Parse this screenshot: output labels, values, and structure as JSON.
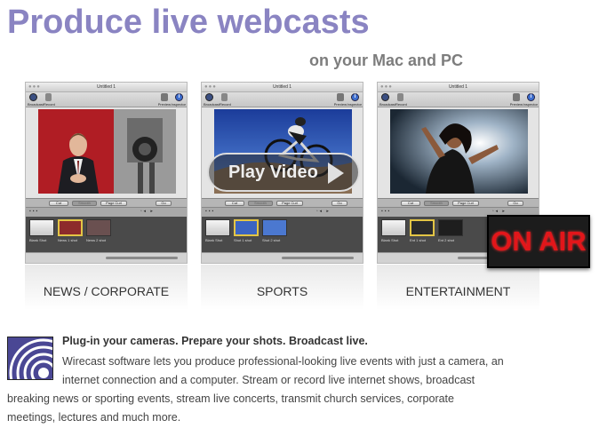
{
  "headline": "Produce live webcasts",
  "subhead": "on your Mac and PC",
  "window": {
    "title": "Untitled 1",
    "toolbar": {
      "broadcast": "Broadcast",
      "record": "Record",
      "preview": "Preview",
      "inspector": "Inspector"
    },
    "buttons": {
      "cut": "Cut",
      "smooth": "Smooth",
      "page_curl": "Page Curl",
      "go": "Go"
    },
    "blank_shot": "Blank Shot"
  },
  "panels": [
    {
      "caption": "NEWS / CORPORATE",
      "shots": [
        "Blank Shot",
        "News 1 shot",
        "News 2 shot"
      ]
    },
    {
      "caption": "SPORTS",
      "shots": [
        "Blank Shot",
        "Shot 1 shot",
        "Shot 2 shot"
      ]
    },
    {
      "caption": "ENTERTAINMENT",
      "shots": [
        "Blank Shot",
        "Ent 1 shot",
        "Ent 2 shot"
      ]
    }
  ],
  "play_video": "Play Video",
  "on_air": "ON AIR",
  "promo": {
    "title": "Plug-in your cameras. Prepare your shots. Broadcast live.",
    "lines": [
      "Wirecast software lets you produce professional-looking live events with just a camera, an",
      "internet connection and a computer. Stream or record live internet shows, broadcast",
      "breaking news or sporting events, stream live concerts, transmit church services, corporate",
      "meetings, lectures and much more."
    ]
  },
  "colors": {
    "headline": "#8a84c2",
    "on_air": "#e2161a",
    "logo_bg": "#4a4794"
  }
}
